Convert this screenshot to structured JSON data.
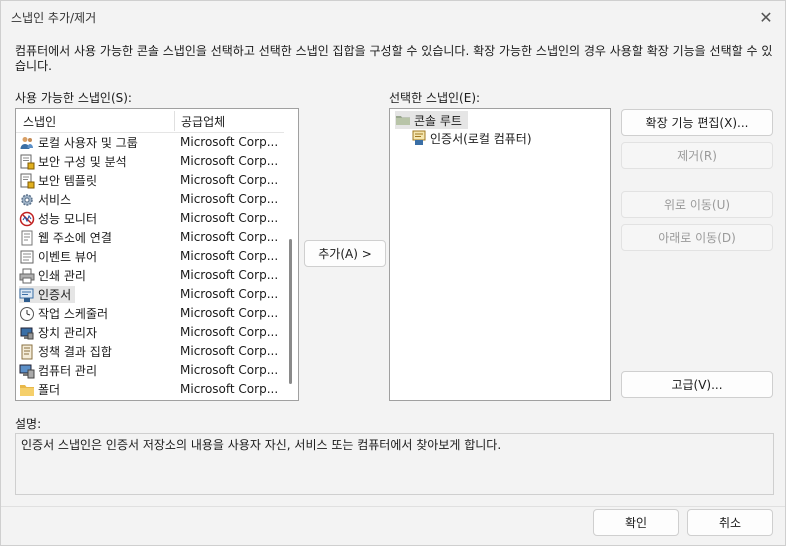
{
  "window": {
    "title": "스냅인 추가/제거",
    "close_glyph": "✕"
  },
  "intro": "컴퓨터에서 사용 가능한 콘솔 스냅인을 선택하고 선택한 스냅인 집합을 구성할 수 있습니다. 확장 가능한 스냅인의 경우 사용할 확장 기능을 선택할 수 있습니다.",
  "available": {
    "label": "사용 가능한 스냅인(S):",
    "columns": {
      "name": "스냅인",
      "vendor": "공급업체"
    },
    "items": [
      {
        "name": "로컬 사용자 및 그룹",
        "vendor": "Microsoft Corp...",
        "icon": "users-icon"
      },
      {
        "name": "보안 구성 및 분석",
        "vendor": "Microsoft Corp...",
        "icon": "security-analysis-icon"
      },
      {
        "name": "보안 템플릿",
        "vendor": "Microsoft Corp...",
        "icon": "security-template-icon"
      },
      {
        "name": "서비스",
        "vendor": "Microsoft Corp...",
        "icon": "services-gear-icon"
      },
      {
        "name": "성능 모니터",
        "vendor": "Microsoft Corp...",
        "icon": "performance-monitor-icon"
      },
      {
        "name": "웹 주소에 연결",
        "vendor": "Microsoft Corp...",
        "icon": "web-link-icon"
      },
      {
        "name": "이벤트 뷰어",
        "vendor": "Microsoft Corp...",
        "icon": "event-viewer-icon"
      },
      {
        "name": "인쇄 관리",
        "vendor": "Microsoft Corp...",
        "icon": "print-management-icon"
      },
      {
        "name": "인증서",
        "vendor": "Microsoft Corp...",
        "icon": "certificate-icon",
        "selected": true
      },
      {
        "name": "작업 스케줄러",
        "vendor": "Microsoft Corp...",
        "icon": "clock-icon"
      },
      {
        "name": "장치 관리자",
        "vendor": "Microsoft Corp...",
        "icon": "device-manager-icon"
      },
      {
        "name": "정책 결과 집합",
        "vendor": "Microsoft Corp...",
        "icon": "policy-result-icon"
      },
      {
        "name": "컴퓨터 관리",
        "vendor": "Microsoft Corp...",
        "icon": "computer-management-icon"
      },
      {
        "name": "폴더",
        "vendor": "Microsoft Corp...",
        "icon": "folder-icon"
      }
    ]
  },
  "add_button": "추가(A) >",
  "selected": {
    "label": "선택한 스냅인(E):",
    "root": "콘솔 루트",
    "child": "인증서(로컬 컴퓨터)"
  },
  "actions": {
    "edit_extensions": "확장 기능 편집(X)...",
    "remove": "제거(R)",
    "move_up": "위로 이동(U)",
    "move_down": "아래로 이동(D)",
    "advanced": "고급(V)..."
  },
  "description": {
    "label": "설명:",
    "text": "인증서 스냅인은 인증서 저장소의 내용을 사용자 자신, 서비스 또는 컴퓨터에서 찾아보게 합니다."
  },
  "footer": {
    "ok": "확인",
    "cancel": "취소"
  }
}
